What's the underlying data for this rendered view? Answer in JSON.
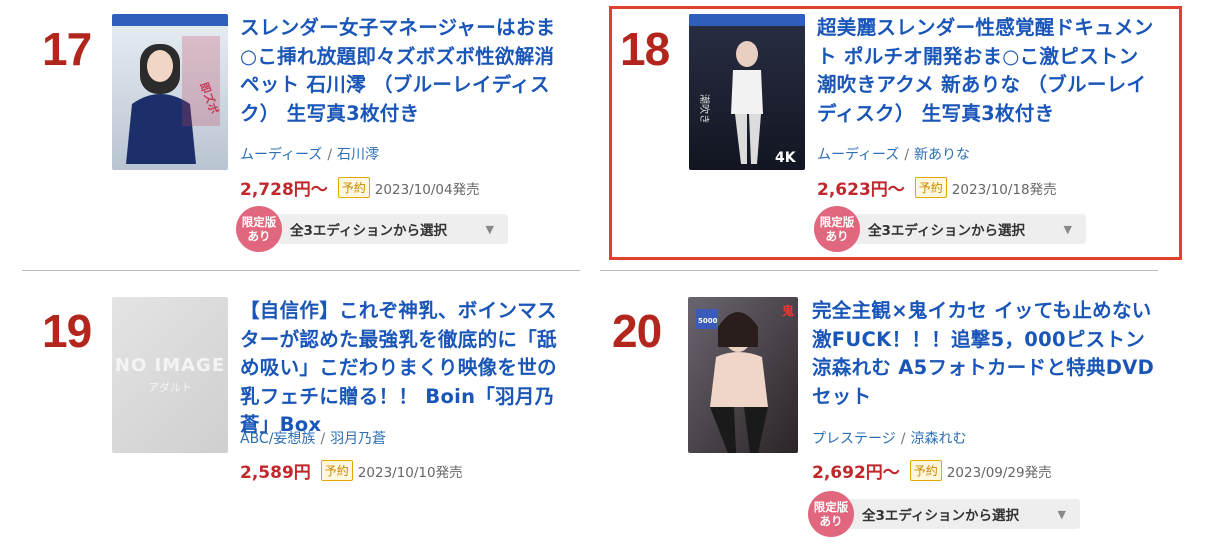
{
  "items": [
    {
      "rank": "17",
      "title": "スレンダー女子マネージャーはおま○こ挿れ放題即々ズボズボ性欲解消ペット 石川澪 （ブルーレイディスク） 生写真3枚付き",
      "maker": "ムーディーズ",
      "actress": "石川澪",
      "price": "2,728円〜",
      "reserve": "予約",
      "date": "2023/10/04発売",
      "limited": [
        "限定版",
        "あり"
      ],
      "edition_select": "全3エディションから選択",
      "cover": "blu-ray-cover"
    },
    {
      "rank": "18",
      "title": "超美麗スレンダー性感覚醒ドキュメント ポルチオ開発おま○こ激ピストン潮吹きアクメ 新ありな （ブルーレイディスク） 生写真3枚付き",
      "maker": "ムーディーズ",
      "actress": "新ありな",
      "price": "2,623円〜",
      "reserve": "予約",
      "date": "2023/10/18発売",
      "limited": [
        "限定版",
        "あり"
      ],
      "edition_select": "全3エディションから選択",
      "cover": "blu-ray-cover"
    },
    {
      "rank": "19",
      "title": "【自信作】これぞ神乳、ボインマスターが認めた最強乳を徹底的に「舐め吸い」こだわりまくり映像を世の乳フェチに贈る！！ Boin「羽月乃蒼」Box",
      "maker": "ABC/妄想族",
      "actress": "羽月乃蒼",
      "price": "2,589円",
      "reserve": "予約",
      "date": "2023/10/10発売",
      "noimage": [
        "NO IMAGE",
        "アダルト"
      ]
    },
    {
      "rank": "20",
      "title": "完全主観×鬼イカセ イッても止めない激FUCK！！！追撃5，000ピストン 涼森れむ A5フォトカードと特典DVDセット",
      "maker": "プレステージ",
      "actress": "涼森れむ",
      "price": "2,692円〜",
      "reserve": "予約",
      "date": "2023/09/29発売",
      "limited": [
        "限定版",
        "あり"
      ],
      "edition_select": "全3エディションから選択",
      "cover": "dvd-cover"
    }
  ],
  "separator": "/",
  "highlight_color": "#e0412a",
  "rank_color": "#b3261e",
  "link_color": "#1a56b8",
  "price_color": "#c0282c"
}
